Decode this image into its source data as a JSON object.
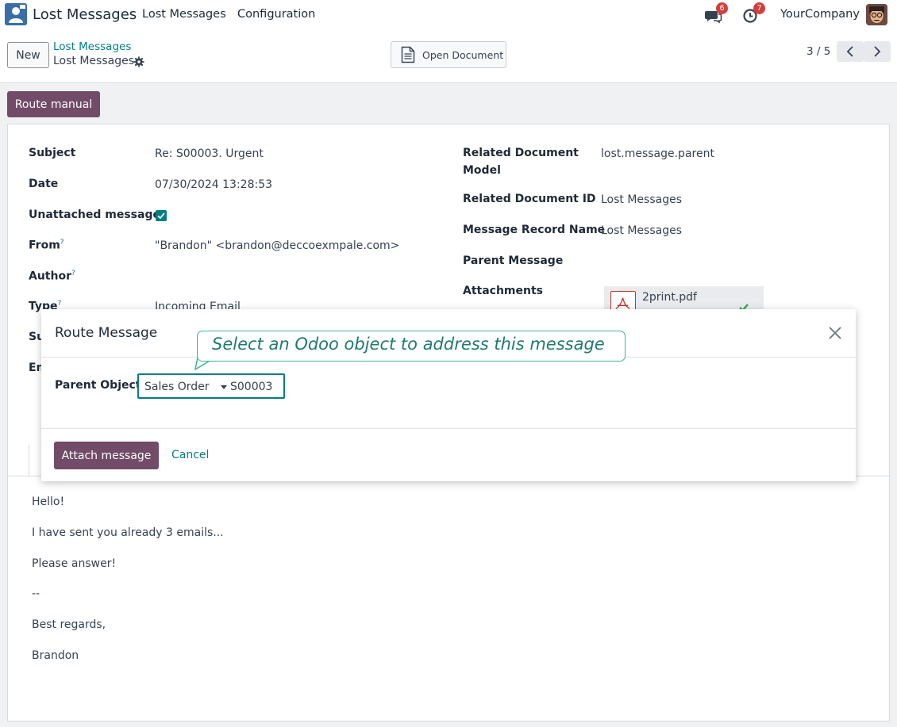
{
  "navbar": {
    "app_title": "Lost Messages",
    "menu": [
      "Lost Messages",
      "Configuration"
    ],
    "messages_badge": "6",
    "activities_badge": "7",
    "company": "YourCompany"
  },
  "control": {
    "new_label": "New",
    "breadcrumb_parent": "Lost Messages",
    "breadcrumb_current": "Lost Messages",
    "open_document_label": "Open Document",
    "pager": "3 / 5"
  },
  "actions": {
    "route_manual_label": "Route manual"
  },
  "form": {
    "left": [
      {
        "label": "Subject",
        "value": "Re: S00003. Urgent",
        "help": ""
      },
      {
        "label": "Date",
        "value": "07/30/2024 13:28:53",
        "help": ""
      },
      {
        "label": "Unattached message",
        "value": "",
        "help": ""
      },
      {
        "label": "From",
        "value": "\"Brandon\" <brandon@deccoexmpale.com>",
        "help": "?"
      },
      {
        "label": "Author",
        "value": "",
        "help": "?"
      },
      {
        "label": "Type",
        "value": "Incoming Email",
        "help": "?"
      },
      {
        "label": "Su",
        "value": "",
        "help": ""
      },
      {
        "label": "Em",
        "value": "",
        "help": ""
      }
    ],
    "right": [
      {
        "label_line1": "Related Document",
        "label_line2": "Model",
        "value": "lost.message.parent"
      },
      {
        "label": "Related Document ID",
        "value": "Lost Messages"
      },
      {
        "label": "Message Record Name",
        "value": "Lost Messages"
      },
      {
        "label": "Parent Message",
        "value": ""
      },
      {
        "label": "Attachments",
        "value": ""
      }
    ],
    "attachment_name": "2print.pdf"
  },
  "message_body": [
    "Hello!",
    "I have sent you already 3 emails...",
    "Please answer!",
    "--",
    "Best regards,",
    "Brandon"
  ],
  "modal": {
    "title": "Route Message",
    "parent_object_label": "Parent Object",
    "model_value": "Sales Order",
    "record_value": "S00003",
    "attach_label": "Attach message",
    "cancel_label": "Cancel"
  },
  "callout": {
    "text": "Select an Odoo object to address this message"
  },
  "colors": {
    "primary": "#714b67",
    "link": "#017e84",
    "callout_border": "#3fb39a",
    "badge": "#d23f3a"
  }
}
